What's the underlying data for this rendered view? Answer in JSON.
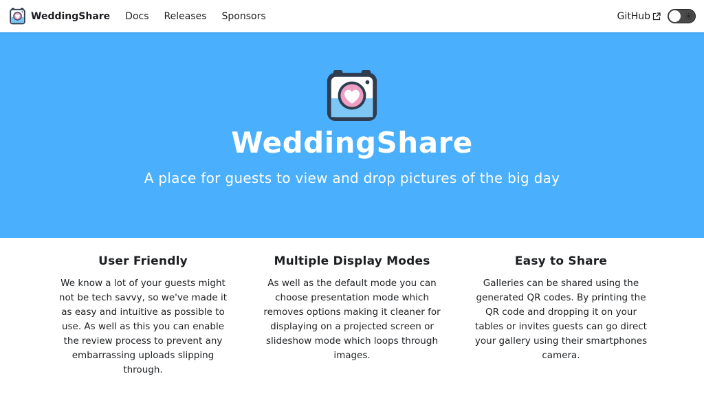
{
  "navbar": {
    "brand_title": "WeddingShare",
    "links": [
      "Docs",
      "Releases",
      "Sponsors"
    ],
    "github_label": "GitHub"
  },
  "hero": {
    "title": "WeddingShare",
    "subtitle": "A place for guests to view and drop pictures of the big day"
  },
  "features": [
    {
      "title": "User Friendly",
      "text": "We know a lot of your guests might not be tech savvy, so we've made it as easy and intuitive as possible to use. As well as this you can enable the review process to prevent any embarrassing uploads slipping through."
    },
    {
      "title": "Multiple Display Modes",
      "text": "As well as the default mode you can choose presentation mode which removes options making it cleaner for displaying on a projected screen or slideshow mode which loops through images."
    },
    {
      "title": "Easy to Share",
      "text": "Galleries can be shared using the generated QR codes. By printing the QR code and dropping it on your tables or invites guests can go direct your gallery using their smartphones camera."
    }
  ],
  "colors": {
    "hero_background": "#4aaffd",
    "text": "#1c1e21",
    "toggle_background": "#4a4a4a"
  },
  "icons": {
    "brand_logo": "camera-heart-icon",
    "external_link": "external-link-icon",
    "theme_toggle": "sun-icon"
  }
}
